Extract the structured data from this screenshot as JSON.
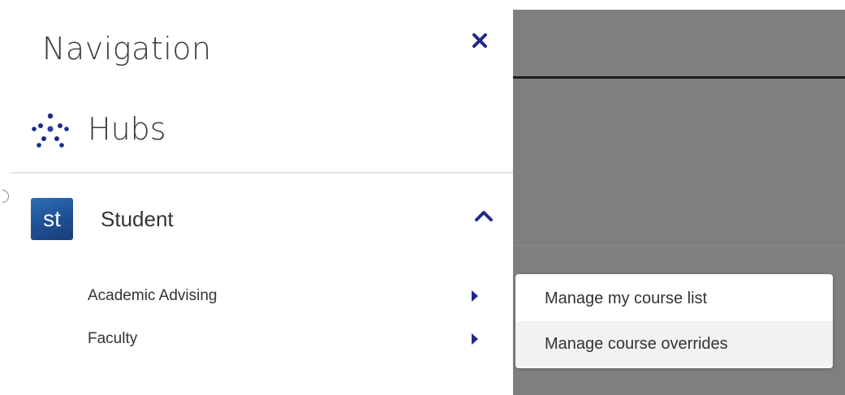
{
  "navigation": {
    "title": "Navigation",
    "close_icon": "close-icon"
  },
  "hubs": {
    "label": "Hubs",
    "icon": "hubs-icon",
    "icon_color": "#1e2a8a"
  },
  "student": {
    "logo_text": "st",
    "label": "Student",
    "expanded": true,
    "toggle_icon": "chevron-up-icon",
    "logo_color": "#2360a8",
    "items": [
      {
        "label": "Academic Advising",
        "icon": "caret-right-icon"
      },
      {
        "label": "Faculty",
        "icon": "caret-right-icon"
      }
    ]
  },
  "submenu": {
    "items": [
      {
        "label": "Manage my course list"
      },
      {
        "label": "Manage course overrides",
        "hovered": true
      }
    ]
  },
  "colors": {
    "accent": "#1e2a8a",
    "overlay": "#7f7f7f"
  }
}
